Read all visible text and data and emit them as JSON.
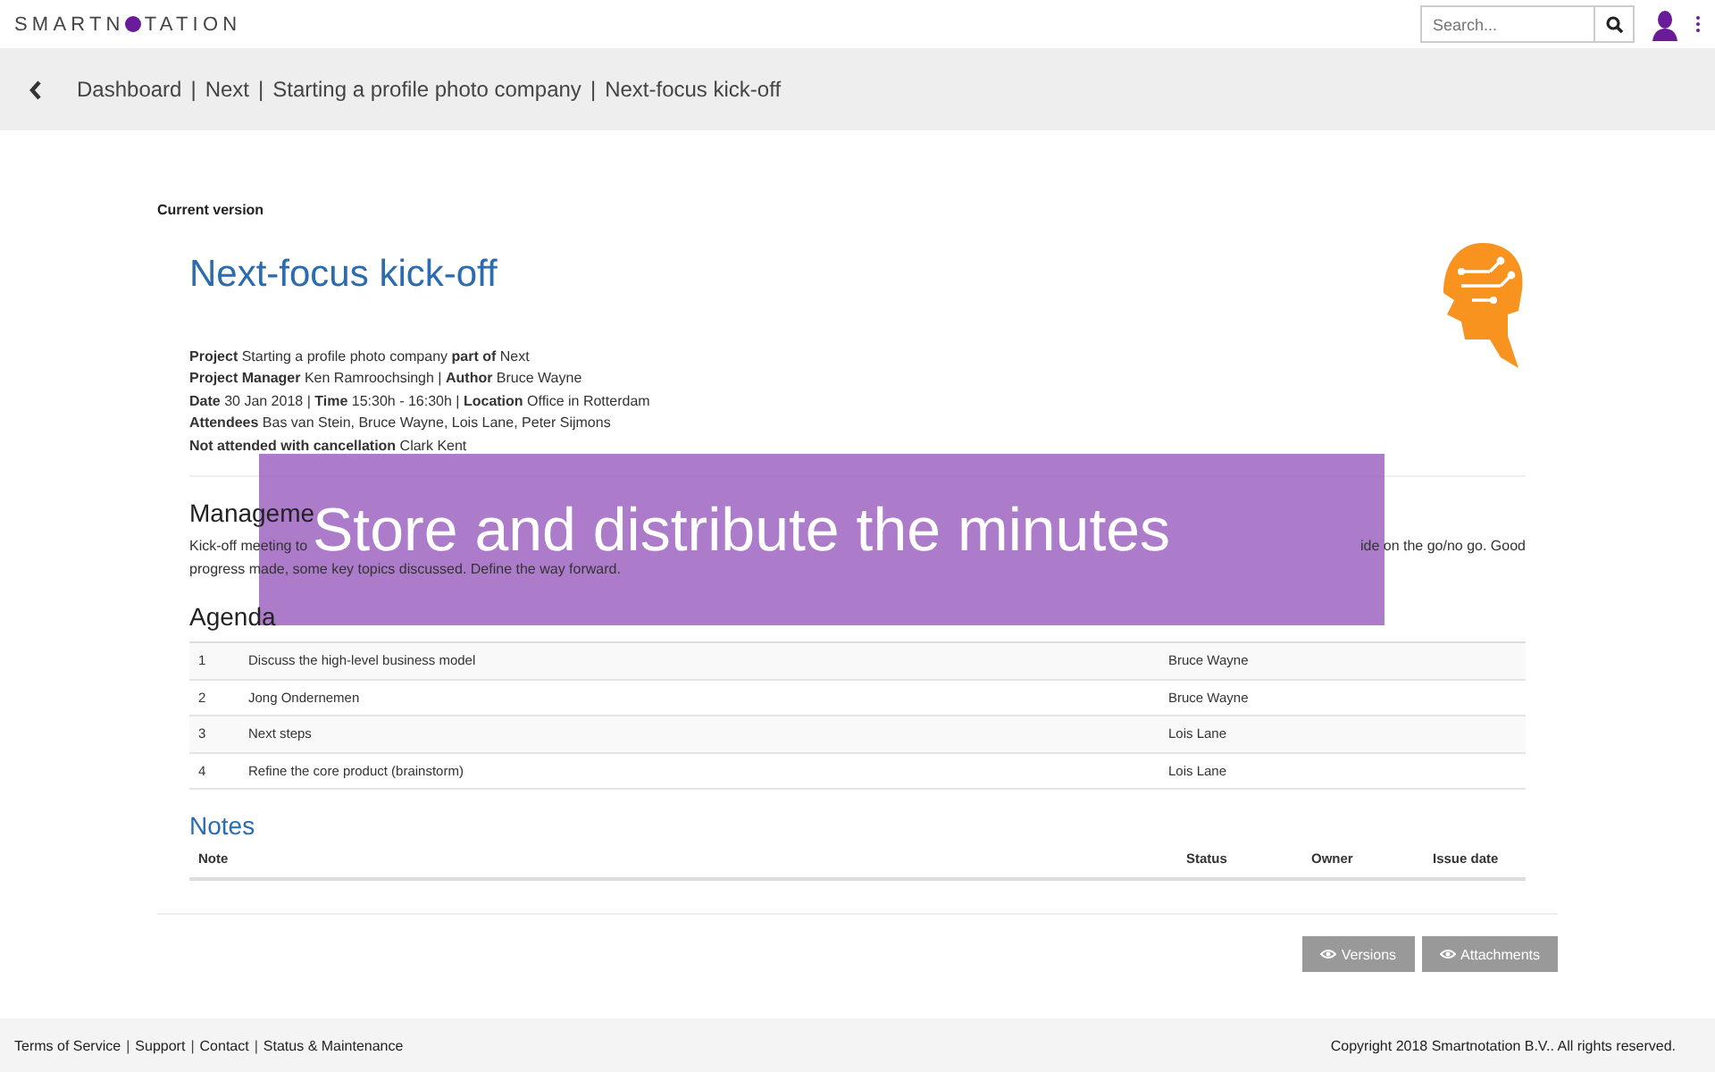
{
  "header": {
    "logo_parts": [
      "SMARTN",
      "TATION"
    ],
    "search": {
      "placeholder": "Search..."
    }
  },
  "separator": "|",
  "breadcrumb": [
    "Dashboard",
    "Next",
    "Starting a profile photo company",
    "Next-focus kick-off"
  ],
  "version_label": "Current version",
  "title": "Next-focus kick-off",
  "meta": [
    "**Project** Starting a profile photo company **part of** Next",
    "**Project Manager** Ken Ramroochsingh | **Author** Bruce Wayne",
    "**Date** 30 Jan 2018 | **Time** 15:30h - 16:30h | **Location** Office in Rotterdam",
    "**Attendees** Bas van Stein, Bruce Wayne, Lois Lane, Peter Sijmons",
    "**Not attended with cancellation** Clark Kent"
  ],
  "summary": {
    "heading": "Manageme",
    "line_1_start": "Kick-off meeting to",
    "line_1_end": "ide on the go/no go. Good",
    "line_2": "progress made, some key topics discussed. Define the way forward."
  },
  "overlay": "Store and distribute the minutes",
  "agenda": {
    "heading": "Agenda",
    "rows": [
      {
        "number": "1",
        "topic": "Discuss the high-level business model",
        "owner": "Bruce Wayne"
      },
      {
        "number": "2",
        "topic": "Jong Ondernemen",
        "owner": "Bruce Wayne"
      },
      {
        "number": "3",
        "topic": "Next steps",
        "owner": "Lois Lane"
      },
      {
        "number": "4",
        "topic": "Refine the core product (brainstorm)",
        "owner": "Lois Lane"
      }
    ]
  },
  "notes": {
    "heading": "Notes",
    "columns": [
      "Note",
      "Status",
      "Owner",
      "Issue date"
    ]
  },
  "buttons": [
    "Versions",
    "Attachments"
  ],
  "footer": {
    "links": [
      "Terms of Service",
      "Support",
      "Contact",
      "Status & Maintenance"
    ],
    "copyright": "Copyright 2018 Smartnotation B.V.. All rights reserved."
  }
}
